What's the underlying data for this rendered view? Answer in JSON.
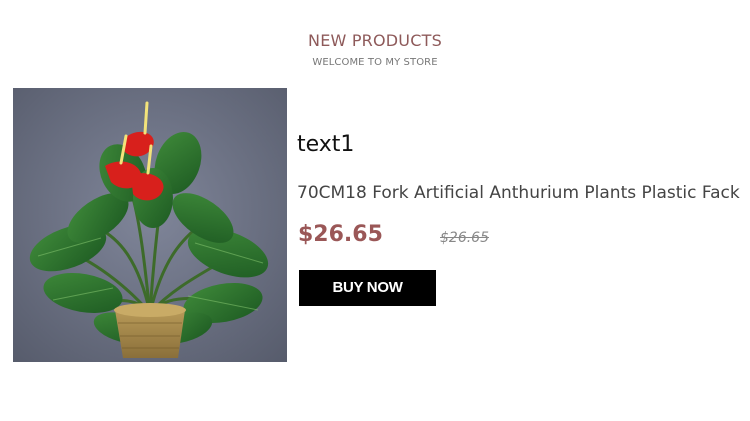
{
  "section": {
    "title": "NEW PRODUCTS",
    "subtitle": "WELCOME TO MY STORE"
  },
  "product": {
    "name": "text1",
    "description": "70CM18 Fork Artificial Anthurium Plants Plastic Fack",
    "price": "$26.65",
    "old_price": "$26.65",
    "buy_label": "BUY NOW",
    "image_subject": "potted artificial anthurium plant"
  },
  "colors": {
    "title": "#8e5a5a",
    "price": "#9a5757",
    "button_bg": "#000000",
    "button_text": "#ffffff"
  }
}
